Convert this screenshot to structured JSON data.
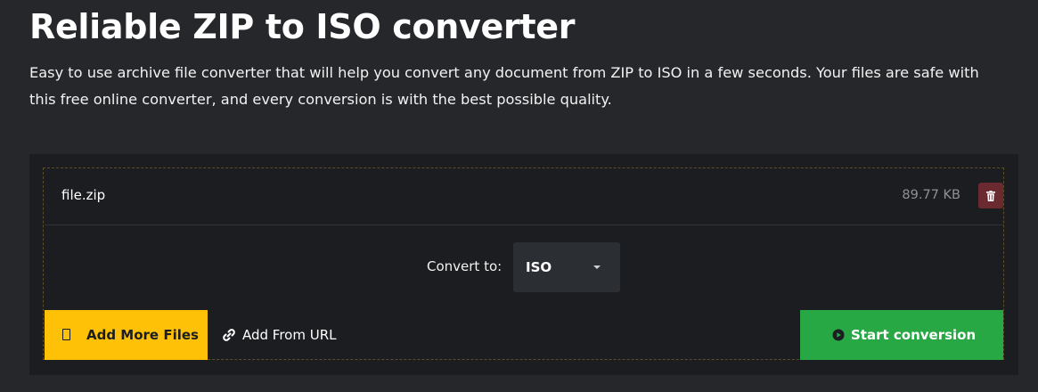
{
  "header": {
    "title": "Reliable ZIP to ISO converter",
    "description": "Easy to use archive file converter that will help you convert any document from ZIP to ISO in a few seconds. Your files are safe with this free online converter, and every conversion is with the best possible quality."
  },
  "file": {
    "name": "file.zip",
    "size": "89.77 KB",
    "delete_icon": "trash-icon"
  },
  "convert": {
    "label": "Convert to:",
    "selected_format": "ISO"
  },
  "actions": {
    "add_more_label": "Add More Files",
    "add_url_label": "Add From URL",
    "start_label": "Start conversion"
  },
  "colors": {
    "background": "#25272b",
    "panel": "#1b1d20",
    "add_more": "#ffc107",
    "start": "#28a745",
    "delete": "#6b2a2f"
  }
}
